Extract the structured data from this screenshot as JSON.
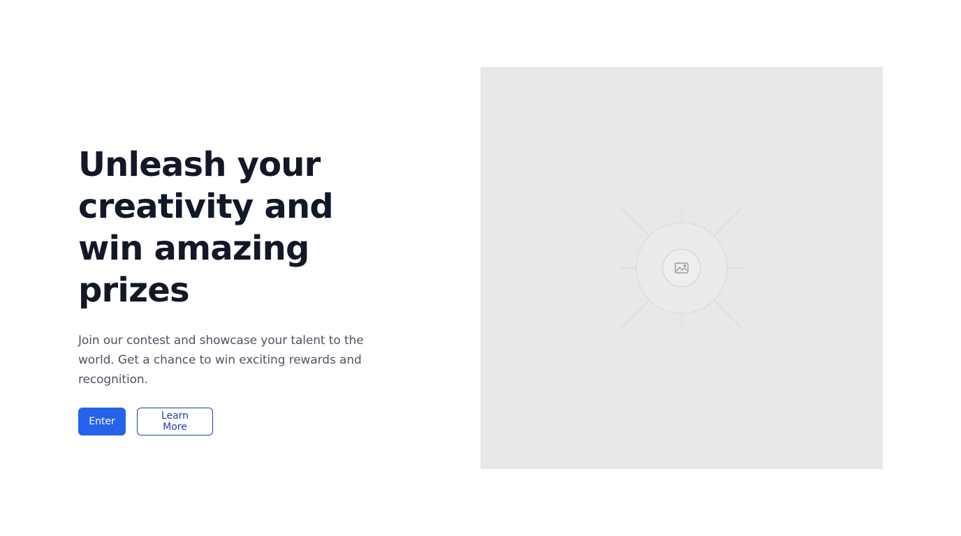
{
  "hero": {
    "headline": "Unleash your creativity and win amazing prizes",
    "subtext": "Join our contest and showcase your talent to the world. Get a chance to win exciting rewards and recognition.",
    "primary_button_label": "Enter",
    "secondary_button_label": "Learn More"
  },
  "image": {
    "icon": "image-icon"
  },
  "colors": {
    "primary": "#2563eb",
    "outline": "#1e40af",
    "heading": "#111827",
    "body_text": "#4b5563",
    "placeholder_bg": "#e8e8e8"
  }
}
